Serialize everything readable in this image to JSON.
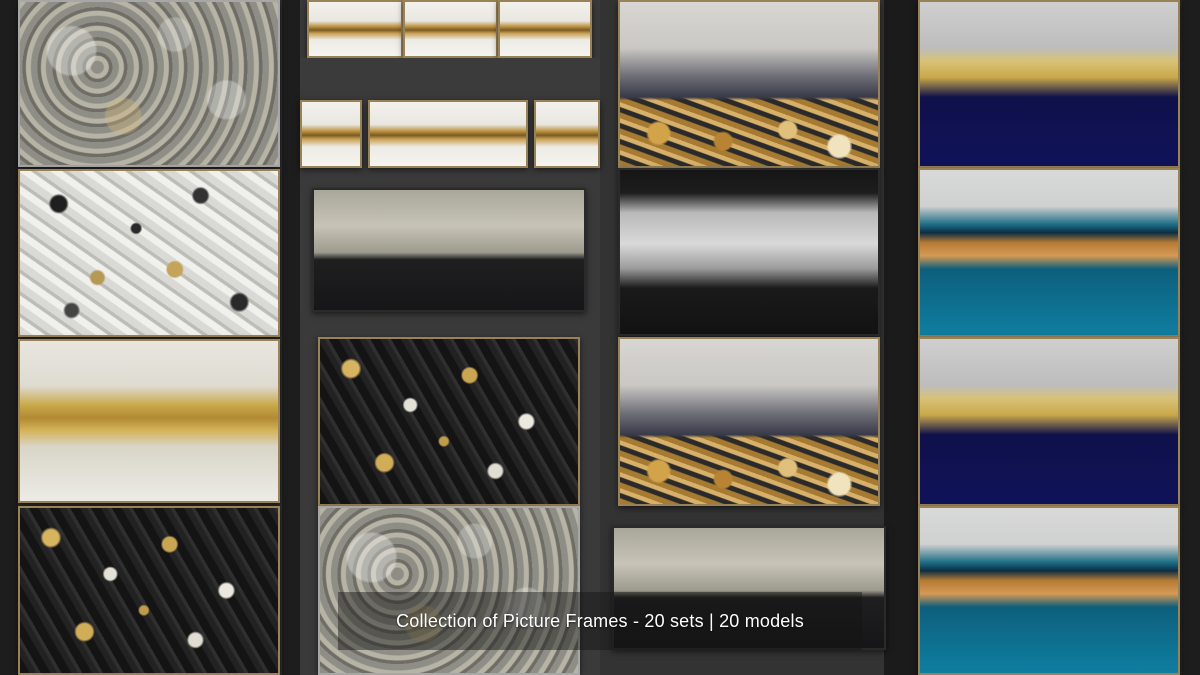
{
  "caption": {
    "text": "Collection of Picture Frames - 20 sets | 20 models"
  },
  "artworks": [
    {
      "name": "silver-pebble-texture",
      "palette": "silver"
    },
    {
      "name": "white-black-fleck",
      "palette": "white/black/gold"
    },
    {
      "name": "gold-band-on-white",
      "palette": "white/gold"
    },
    {
      "name": "black-gold-splatter",
      "palette": "black/gold"
    },
    {
      "name": "white-gold-triptych",
      "palette": "white/gold"
    },
    {
      "name": "silver-black-drip",
      "palette": "silver/black"
    },
    {
      "name": "gray-gold-dots",
      "palette": "gray/gold"
    },
    {
      "name": "silver-black-wave",
      "palette": "silver/black"
    },
    {
      "name": "navy-gold",
      "palette": "navy/gold"
    },
    {
      "name": "teal-gold",
      "palette": "teal/gold"
    }
  ],
  "colors": {
    "frame_gold": "#9a8258",
    "background": "#2b2b2b"
  }
}
